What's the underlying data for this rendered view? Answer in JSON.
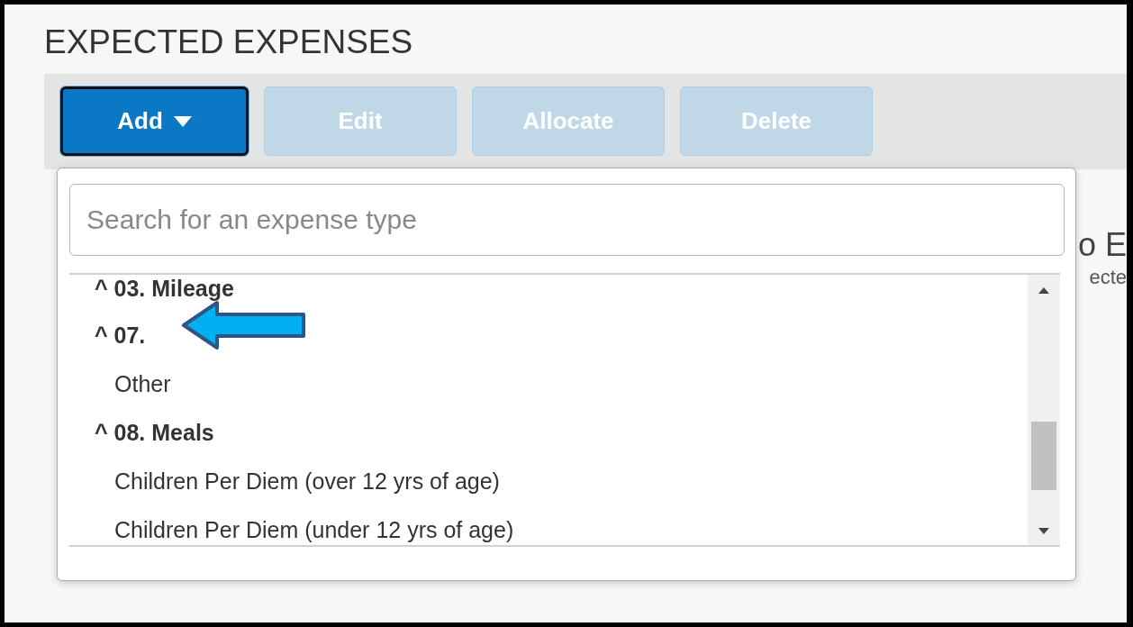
{
  "title": "EXPECTED EXPENSES",
  "toolbar": [
    {
      "label": "Add",
      "kind": "dropdown",
      "disabled": false
    },
    {
      "label": "Edit",
      "kind": "plain",
      "disabled": true
    },
    {
      "label": "Allocate",
      "kind": "plain",
      "disabled": true
    },
    {
      "label": "Delete",
      "kind": "plain",
      "disabled": true
    }
  ],
  "background": {
    "heading": "o E",
    "subtitle": "ecte"
  },
  "dropdown": {
    "search": {
      "placeholder": "Search for an expense type"
    },
    "items": [
      {
        "kind": "group",
        "label": "^",
        "text": "03. Mileage"
      },
      {
        "kind": "group",
        "label": "^",
        "text": "07."
      },
      {
        "kind": "item",
        "text": "Other"
      },
      {
        "kind": "group",
        "label": "^",
        "text": "08. Meals"
      },
      {
        "kind": "item",
        "text": "Children Per Diem (over 12 yrs of age)"
      },
      {
        "kind": "item",
        "text": "Children Per Diem (under 12 yrs of age)"
      }
    ]
  }
}
